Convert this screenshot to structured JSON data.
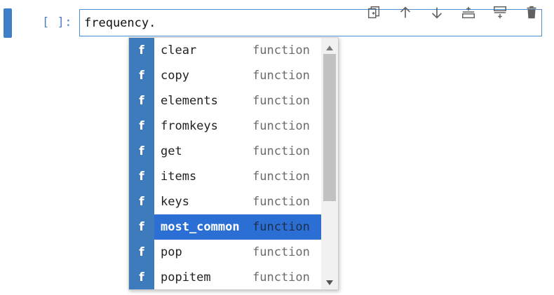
{
  "cell": {
    "prompt": "[ ]:",
    "input_text": "frequency."
  },
  "toolbar": {
    "buttons": [
      {
        "name": "duplicate-cell",
        "icon": "copy-icon"
      },
      {
        "name": "move-up",
        "icon": "arrow-up-icon"
      },
      {
        "name": "move-down",
        "icon": "arrow-down-icon"
      },
      {
        "name": "insert-above",
        "icon": "insert-above-icon"
      },
      {
        "name": "insert-below",
        "icon": "insert-below-icon"
      },
      {
        "name": "delete-cell",
        "icon": "trash-icon"
      }
    ]
  },
  "completer": {
    "icon_letter": "f",
    "active_index": 7,
    "items": [
      {
        "label": "clear",
        "type": "function"
      },
      {
        "label": "copy",
        "type": "function"
      },
      {
        "label": "elements",
        "type": "function"
      },
      {
        "label": "fromkeys",
        "type": "function"
      },
      {
        "label": "get",
        "type": "function"
      },
      {
        "label": "items",
        "type": "function"
      },
      {
        "label": "keys",
        "type": "function"
      },
      {
        "label": "most_common",
        "type": "function"
      },
      {
        "label": "pop",
        "type": "function"
      },
      {
        "label": "popitem",
        "type": "function"
      }
    ]
  },
  "colors": {
    "accent": "#3f7fc7",
    "selection": "#2b6fd4",
    "icon_bg": "#3d7bbd"
  }
}
